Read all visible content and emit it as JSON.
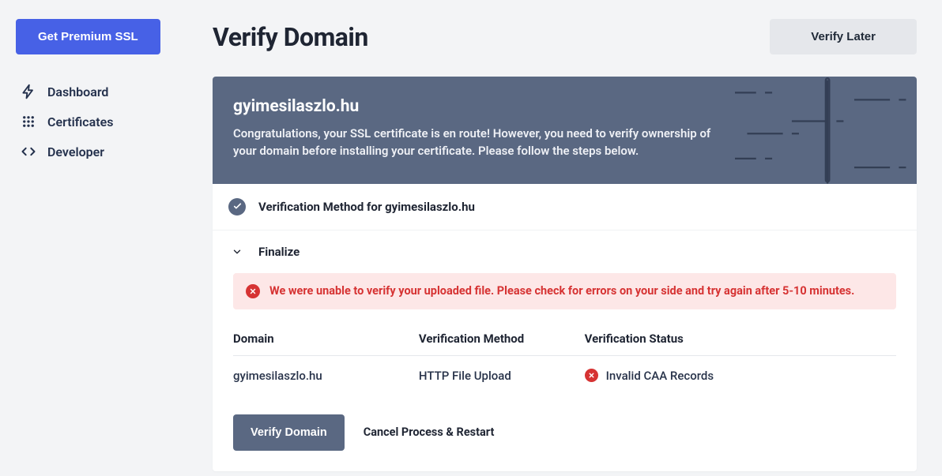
{
  "sidebar": {
    "premium_button": "Get Premium SSL",
    "items": [
      {
        "label": "Dashboard"
      },
      {
        "label": "Certificates"
      },
      {
        "label": "Developer"
      }
    ]
  },
  "header": {
    "title": "Verify Domain",
    "verify_later": "Verify Later"
  },
  "banner": {
    "domain": "gyimesilaszlo.hu",
    "message": "Congratulations, your SSL certificate is en route! However, you need to verify ownership of your domain before installing your certificate. Please follow the steps below."
  },
  "steps": {
    "method_label": "Verification Method for gyimesilaszlo.hu",
    "finalize_label": "Finalize"
  },
  "alert": {
    "text": "We were unable to verify your uploaded file. Please check for errors on your side and try again after 5-10 minutes."
  },
  "table": {
    "headers": {
      "domain": "Domain",
      "method": "Verification Method",
      "status": "Verification Status"
    },
    "row": {
      "domain": "gyimesilaszlo.hu",
      "method": "HTTP File Upload",
      "status": "Invalid CAA Records"
    }
  },
  "actions": {
    "verify": "Verify Domain",
    "cancel": "Cancel Process & Restart"
  }
}
